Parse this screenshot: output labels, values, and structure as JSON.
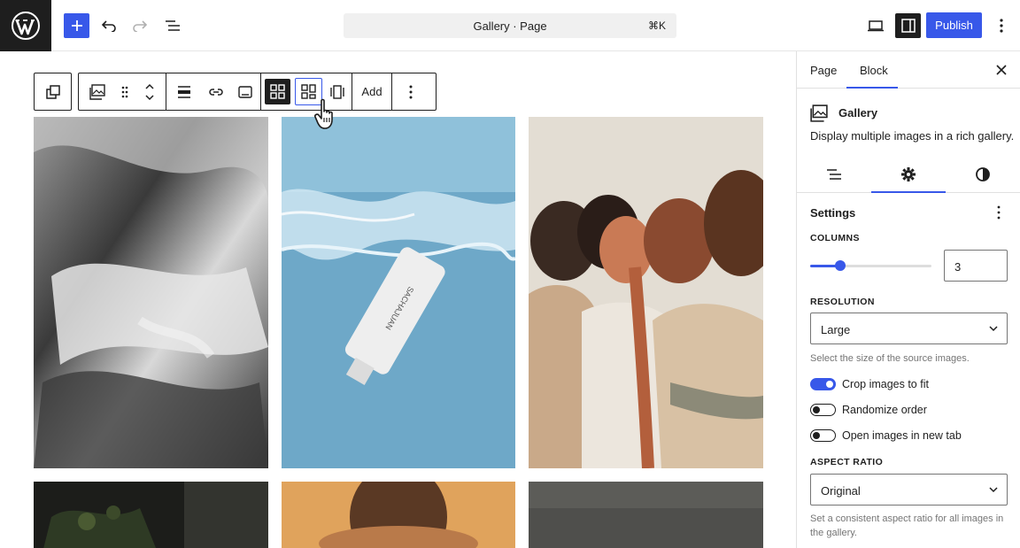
{
  "topbar": {
    "document_title": "Gallery · Page",
    "shortcut": "⌘K",
    "publish_label": "Publish"
  },
  "block_toolbar": {
    "add_label": "Add"
  },
  "sidebar": {
    "tabs": [
      {
        "label": "Page",
        "active": false
      },
      {
        "label": "Block",
        "active": true
      }
    ],
    "block": {
      "name": "Gallery",
      "description": "Display multiple images in a rich gallery."
    },
    "settings": {
      "title": "Settings",
      "columns_label": "COLUMNS",
      "columns_value": "3",
      "columns_fraction": 0.25,
      "resolution_label": "RESOLUTION",
      "resolution_value": "Large",
      "resolution_help": "Select the size of the source images.",
      "toggles": [
        {
          "label": "Crop images to fit",
          "on": true
        },
        {
          "label": "Randomize order",
          "on": false
        },
        {
          "label": "Open images in new tab",
          "on": false
        }
      ],
      "aspect_label": "ASPECT RATIO",
      "aspect_value": "Original",
      "aspect_help": "Set a consistent aspect ratio for all images in the gallery."
    }
  },
  "colors": {
    "accent": "#3858e9",
    "dark": "#1e1e1e"
  }
}
